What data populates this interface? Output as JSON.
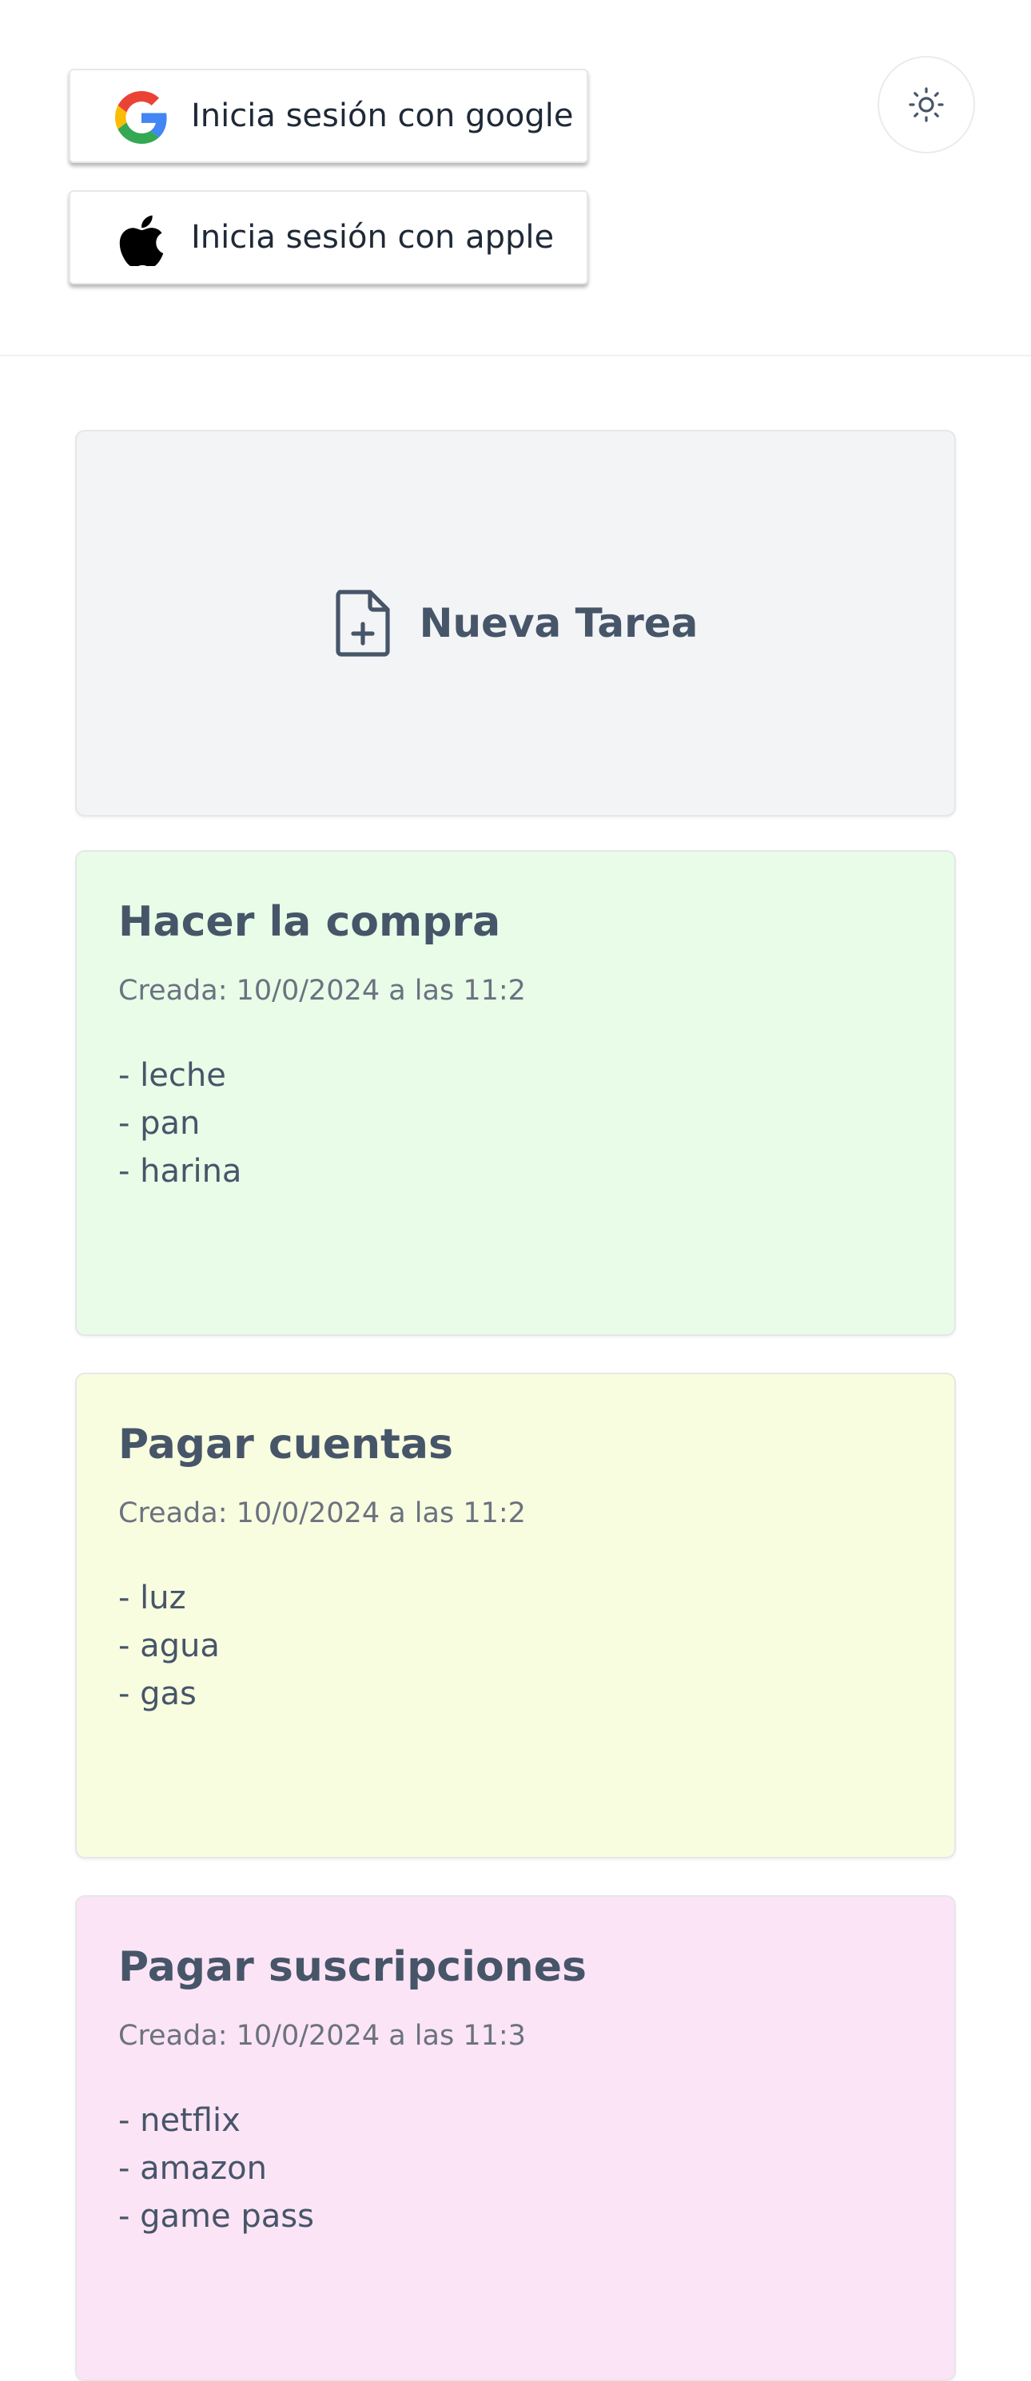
{
  "auth": {
    "google_label": "Inicia sesión con google",
    "apple_label": "Inicia sesión con apple"
  },
  "theme_toggle": {
    "icon": "sun-icon"
  },
  "new_task": {
    "label": "Nueva Tarea",
    "icon": "file-plus-icon"
  },
  "tasks": [
    {
      "title": "Hacer la compra",
      "created": "Creada: 10/0/2024 a las 11:2",
      "items": [
        "- leche",
        "- pan",
        "- harina"
      ],
      "color": "#e8fce8"
    },
    {
      "title": "Pagar cuentas",
      "created": "Creada: 10/0/2024 a las 11:2",
      "items": [
        "- luz",
        "- agua",
        "- gas"
      ],
      "color": "#f8fddf"
    },
    {
      "title": "Pagar suscripciones",
      "created": "Creada: 10/0/2024 a las 11:3",
      "items": [
        "- netflix",
        "- amazon",
        "- game pass"
      ],
      "color": "#fbe4f5"
    }
  ]
}
